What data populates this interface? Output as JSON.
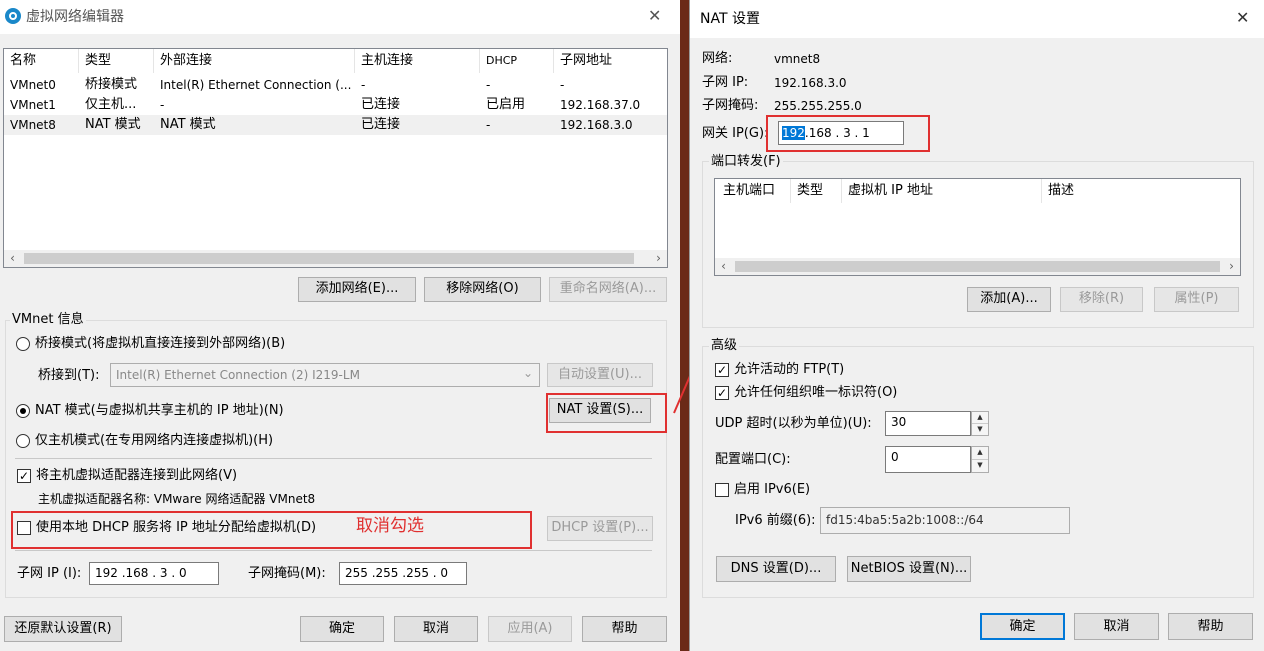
{
  "left_dialog": {
    "title": "虚拟网络编辑器",
    "close_glyph": "✕",
    "table": {
      "headers": [
        "名称",
        "类型",
        "外部连接",
        "主机连接",
        "DHCP",
        "子网地址"
      ],
      "rows": [
        [
          "VMnet0",
          "桥接模式",
          "Intel(R) Ethernet Connection (...",
          "-",
          "-",
          "-"
        ],
        [
          "VMnet1",
          "仅主机...",
          "-",
          "已连接",
          "已启用",
          "192.168.37.0"
        ],
        [
          "VMnet8",
          "NAT 模式",
          "NAT 模式",
          "已连接",
          "-",
          "192.168.3.0"
        ]
      ]
    },
    "buttons": {
      "add_network": "添加网络(E)...",
      "remove_network": "移除网络(O)",
      "rename_network": "重命名网络(A)..."
    },
    "vmnet_info_label": "VMnet 信息",
    "bridge_mode": "桥接模式(将虚拟机直接连接到外部网络)(B)",
    "bridge_to_label": "桥接到(T):",
    "bridge_to_value": "Intel(R) Ethernet Connection (2) I219-LM",
    "auto_settings": "自动设置(U)...",
    "nat_mode": "NAT 模式(与虚拟机共享主机的 IP 地址)(N)",
    "nat_settings": "NAT 设置(S)...",
    "host_only_mode": "仅主机模式(在专用网络内连接虚拟机)(H)",
    "connect_host_adapter": "将主机虚拟适配器连接到此网络(V)",
    "host_adapter_name": "主机虚拟适配器名称: VMware 网络适配器 VMnet8",
    "use_local_dhcp": "使用本地 DHCP 服务将 IP 地址分配给虚拟机(D)",
    "annotation": "取消勾选",
    "dhcp_settings": "DHCP 设置(P)...",
    "subnet_ip_label": "子网 IP (I):",
    "subnet_ip_value": "192 .168 . 3  . 0",
    "subnet_mask_label": "子网掩码(M):",
    "subnet_mask_value": "255 .255 .255 . 0",
    "restore_defaults": "还原默认设置(R)",
    "ok": "确定",
    "cancel": "取消",
    "apply": "应用(A)",
    "help": "帮助"
  },
  "nat_dialog": {
    "title": "NAT 设置",
    "close_glyph": "✕",
    "network_label": "网络:",
    "network_value": "vmnet8",
    "subnet_ip_label": "子网 IP:",
    "subnet_ip_value": "192.168.3.0",
    "subnet_mask_label": "子网掩码:",
    "subnet_mask_value": "255.255.255.0",
    "gateway_label": "网关 IP(G):",
    "gateway_first": "192",
    "gateway_rest": ".168 . 3  . 1",
    "port_forwarding_label": "端口转发(F)",
    "pf_headers": [
      "主机端口",
      "类型",
      "虚拟机 IP 地址",
      "描述"
    ],
    "add": "添加(A)...",
    "remove": "移除(R)",
    "properties": "属性(P)",
    "advanced_label": "高级",
    "allow_ftp": "允许活动的 FTP(T)",
    "allow_oui": "允许任何组织唯一标识符(O)",
    "udp_timeout_label": "UDP 超时(以秒为单位)(U):",
    "udp_timeout_value": "30",
    "config_port_label": "配置端口(C):",
    "config_port_value": "0",
    "enable_ipv6": "启用 IPv6(E)",
    "ipv6_prefix_label": "IPv6 前缀(6):",
    "ipv6_prefix_value": "fd15:4ba5:5a2b:1008::/64",
    "dns_settings": "DNS 设置(D)...",
    "netbios_settings": "NetBIOS 设置(N)...",
    "ok": "确定",
    "cancel": "取消",
    "help": "帮助"
  },
  "colors": {
    "annotation_red": "#e03030",
    "selection_blue": "#0078d7"
  },
  "icons": {
    "app": "vmware-network-icon",
    "check": "✓",
    "arrow_left": "‹",
    "arrow_right": "›",
    "combo": "⌄",
    "spin_up": "▲",
    "spin_down": "▼"
  }
}
